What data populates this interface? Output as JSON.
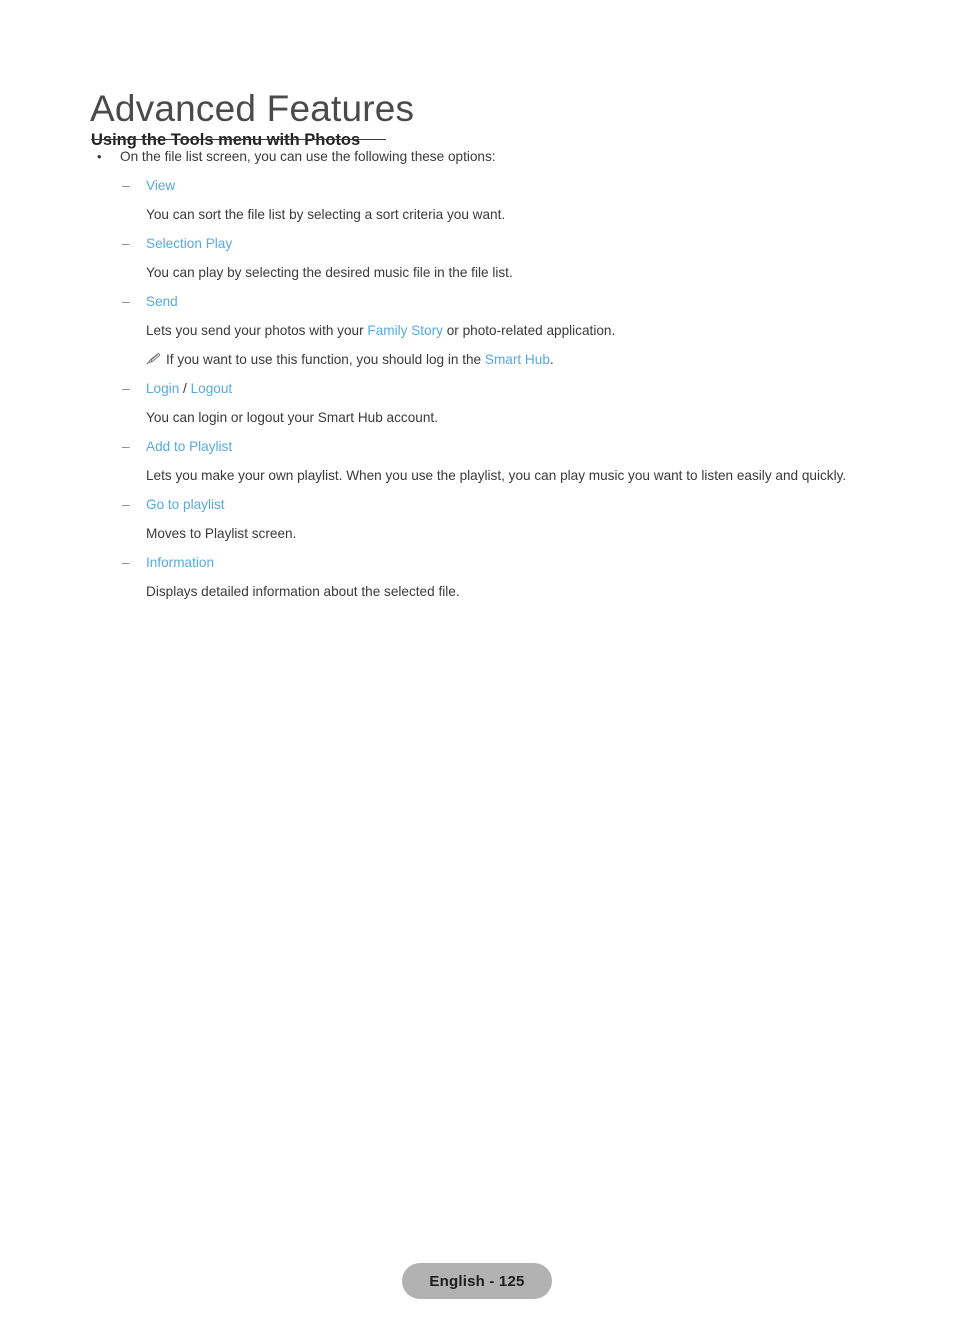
{
  "document": {
    "chapter_title": "Advanced Features",
    "section_heading": "Using the Tools menu with Photos",
    "intro_bullet": {
      "marker": "•",
      "text": "On the file list screen, you can use the following these options:"
    },
    "dash_marker": "–",
    "note_icon": "pencil-note-icon",
    "accent_link_color": "#55aae4",
    "body_text_color": "#3a3a3a",
    "options": [
      {
        "term": "View",
        "description": "You can sort the file list by selecting a sort criteria you want."
      },
      {
        "term": "Selection Play",
        "description": "You can play by selecting the desired music file in the file list."
      },
      {
        "term": "Send",
        "desc_prefix": "Lets you send your photos with your ",
        "desc_link": "Family Story",
        "desc_suffix": " or photo-related application.",
        "note_prefix": "If you want to use this function, you should log in the ",
        "note_link": "Smart Hub",
        "note_suffix": "."
      },
      {
        "term_a": "Login",
        "term_separator": " / ",
        "term_b": "Logout",
        "description": "You can login or logout your Smart Hub account."
      },
      {
        "term": "Add to Playlist",
        "description": "Lets you make your own playlist. When you use the playlist, you can play music you want to listen easily and quickly."
      },
      {
        "term": "Go to playlist",
        "description": "Moves to Playlist screen."
      },
      {
        "term": "Information",
        "description": "Displays detailed information about the selected file."
      }
    ]
  },
  "footer": {
    "badge_label": "English - 125",
    "badge_color": "#b2b2b2"
  }
}
